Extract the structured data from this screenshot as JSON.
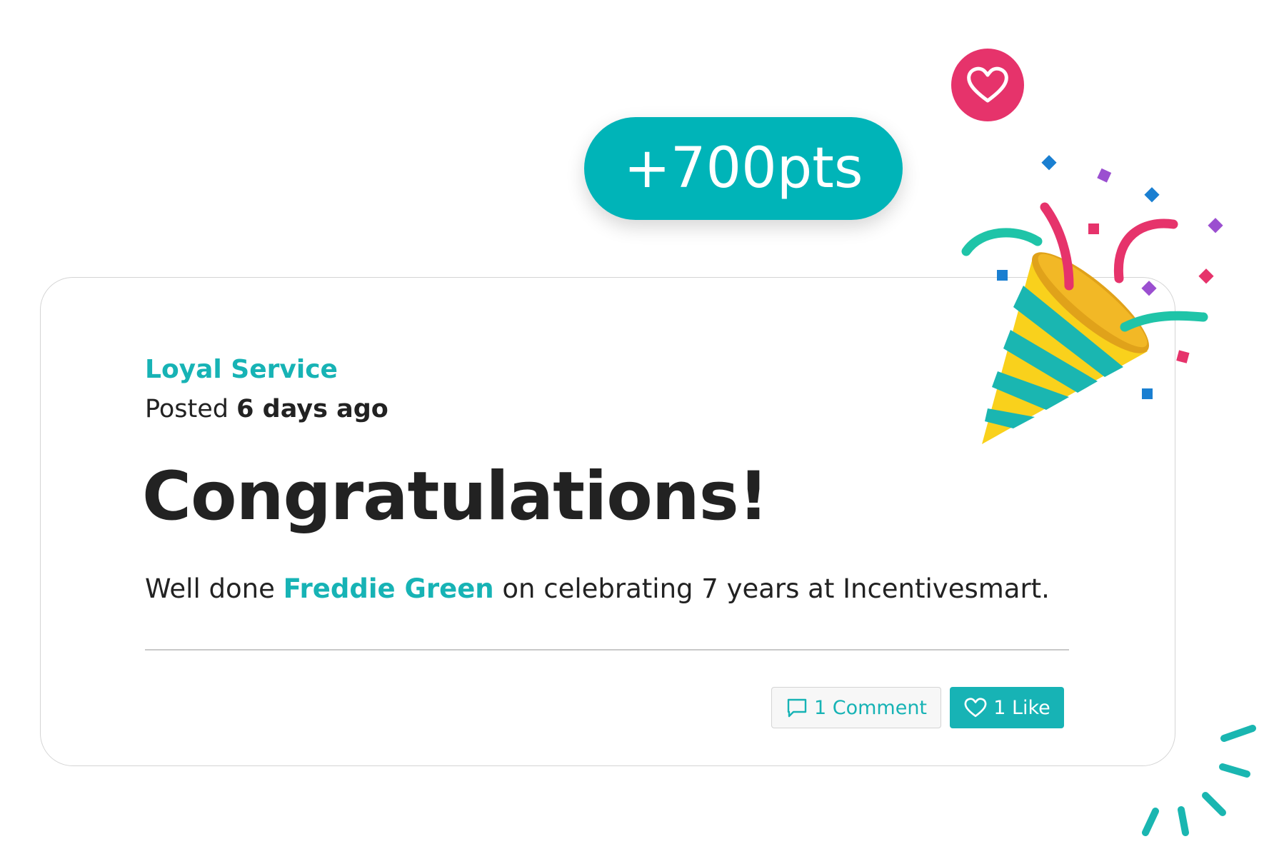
{
  "badge": {
    "points_label": "+700pts",
    "icon": "heart-icon"
  },
  "post": {
    "category": "Loyal Service",
    "posted_prefix": "Posted",
    "posted_when": "6 days ago",
    "headline": "Congratulations!",
    "message_prefix": "Well done",
    "recipient": "Freddie Green",
    "message_suffix": "on celebrating 7 years at Incentivesmart."
  },
  "actions": {
    "comment_label": "1 Comment",
    "comment_icon": "speech-bubble-icon",
    "like_label": "1 Like",
    "like_icon": "heart-outline-icon"
  },
  "decoration": {
    "popper_icon": "party-popper-icon",
    "sparks_icon": "burst-lines-icon"
  },
  "colors": {
    "accent": "#17b3b5",
    "heart": "#e6336b",
    "text": "#222222",
    "popper_yellow": "#f9d11c"
  }
}
